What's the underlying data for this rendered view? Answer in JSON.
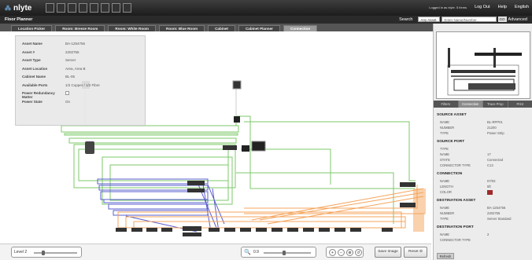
{
  "app": {
    "logo": "nlyte",
    "page_title": "Floor Planner"
  },
  "topbar": {
    "user": "Logged in as nlyte. 5 Items",
    "logout": "Log Out",
    "help": "Help",
    "lang": "English"
  },
  "search": {
    "label": "Search",
    "type": "Any Asset",
    "placeholder": "Enter Name/Number",
    "go": "GO",
    "advanced": "Advanced"
  },
  "tabs": [
    "Location Picker",
    "Room: Breeze Room",
    "Room: White Room",
    "Room: Blue Room",
    "Cabinet",
    "Cabinet Planner",
    "Connection"
  ],
  "asset_info": [
    {
      "k": "Asset Name",
      "v": "BA-1254756"
    },
    {
      "k": "Asset #",
      "v": "2202755"
    },
    {
      "k": "Asset Type",
      "v": "Server"
    },
    {
      "k": "Asset Location",
      "v": "Area, Area B"
    },
    {
      "k": "Cabinet Name",
      "v": "BL-05"
    },
    {
      "k": "Available Ports",
      "v": "1/2 Copper / 1/2 Fibre"
    },
    {
      "k": "Power Redundancy Matter",
      "v": ""
    },
    {
      "k": "Power State",
      "v": "On"
    }
  ],
  "bottom": {
    "level": "Level 2",
    "zoom": "0.9",
    "save": "Save Image",
    "reset": "Reset"
  },
  "right_tabs": [
    "Filters",
    "Connection",
    "Trace Prop",
    "Print"
  ],
  "source_asset": {
    "title": "SOURCE ASSET",
    "rows": [
      {
        "k": "NAME",
        "v": "BL-RPP01"
      },
      {
        "k": "NUMBER",
        "v": "21200"
      },
      {
        "k": "TYPE",
        "v": "Power Strip"
      }
    ]
  },
  "source_port": {
    "title": "SOURCE PORT",
    "rows": [
      {
        "k": "TYPE",
        "v": ""
      },
      {
        "k": "NAME",
        "v": "17"
      },
      {
        "k": "STATE",
        "v": "Connected"
      },
      {
        "k": "CONNECTOR TYPE",
        "v": "C13"
      }
    ]
  },
  "connection": {
    "title": "CONNECTION",
    "rows": [
      {
        "k": "NAME",
        "v": "07/03"
      },
      {
        "k": "LENGTH",
        "v": "5ft"
      },
      {
        "k": "COLOR",
        "v": ""
      }
    ],
    "color": "#9e2a2a"
  },
  "dest_asset": {
    "title": "DESTINATION ASSET",
    "rows": [
      {
        "k": "NAME",
        "v": "BA-1254756"
      },
      {
        "k": "NUMBER",
        "v": "2202755"
      },
      {
        "k": "TYPE",
        "v": "Server Standard"
      }
    ]
  },
  "dest_port": {
    "title": "DESTINATION PORT",
    "rows": [
      {
        "k": "NAME",
        "v": "2"
      },
      {
        "k": "CONNECTOR TYPE",
        "v": ""
      }
    ]
  },
  "refresh": "Refresh"
}
